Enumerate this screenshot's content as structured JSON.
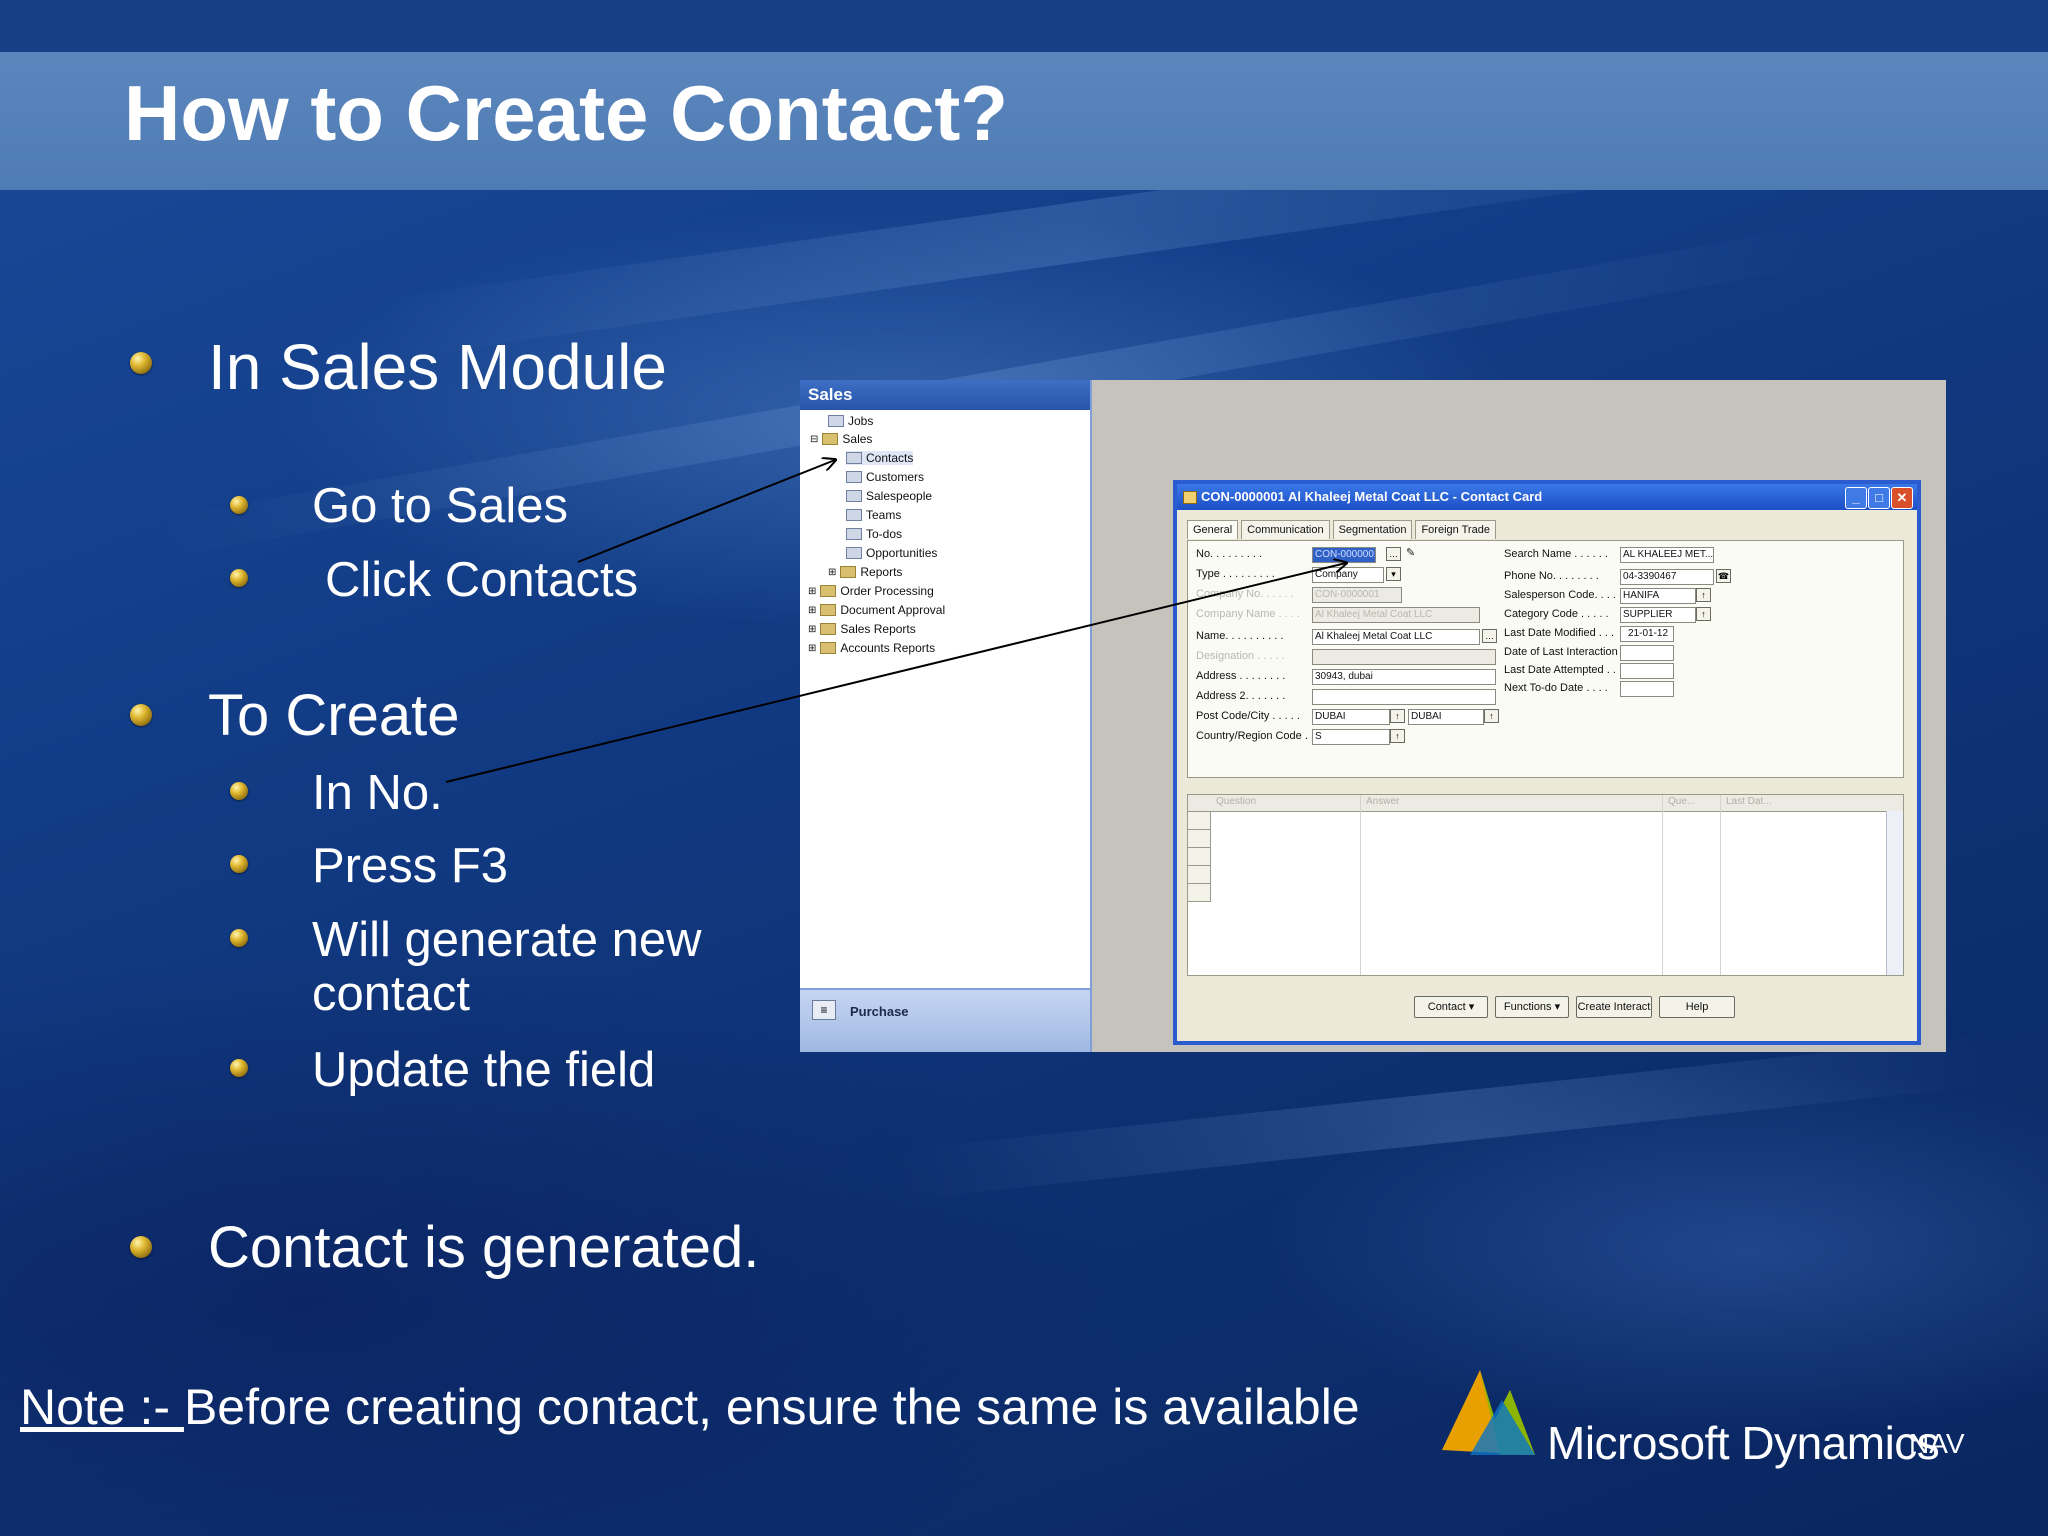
{
  "slide": {
    "title": "How to Create Contact?",
    "bullets": {
      "b1": "In Sales Module",
      "b1_1": "Go to Sales",
      "b1_2": "Click Contacts",
      "b2": "To Create",
      "b2_1": "In No.",
      "b2_2": "Press F3",
      "b2_3a": "Will generate new",
      "b2_3b": "contact",
      "b2_4": "Update the field",
      "b3": "Contact is generated."
    },
    "note": {
      "prefix": "Note :- ",
      "text": "Before creating contact, ensure the same is available"
    },
    "logo": {
      "brand": "Microsoft Dynamics",
      "suffix": "NAV"
    }
  },
  "nav_pane": {
    "header": "Sales",
    "tree": {
      "jobs": "Jobs",
      "sales": "Sales",
      "contacts": "Contacts",
      "customers": "Customers",
      "salespeople": "Salespeople",
      "teams": "Teams",
      "todos": "To-dos",
      "opportunities": "Opportunities",
      "reports": "Reports",
      "order_processing": "Order Processing",
      "document_approval": "Document Approval",
      "sales_reports": "Sales Reports",
      "accounts_reports": "Accounts Reports"
    },
    "footer": "Purchase"
  },
  "contact_card": {
    "window_title": "CON-0000001 Al Khaleej Metal Coat LLC - Contact Card",
    "tabs": {
      "general": "General",
      "communication": "Communication",
      "segmentation": "Segmentation",
      "foreign_trade": "Foreign Trade"
    },
    "left_labels": {
      "no": "No. . . . . . . . .",
      "type": "Type . . . . . . . . .",
      "company_no": "Company No. . . . . .",
      "company_name": "Company Name . . . .",
      "name": "Name. . . . . . . . . .",
      "designation": "Designation . . . . .",
      "address": "Address . . . . . . . .",
      "address2": "Address 2. . . . . . .",
      "post_code": "Post Code/City . . . . .",
      "country": "Country/Region Code . ."
    },
    "left_values": {
      "no": "CON-0000001",
      "type": "Company",
      "company_no": "CON-0000001",
      "company_name": "Al Khaleej Metal Coat LLC",
      "name": "Al Khaleej Metal Coat LLC",
      "designation": "",
      "address": "30943, dubai",
      "address2": "",
      "post_code": "DUBAI",
      "city": "DUBAI",
      "country": "S"
    },
    "right_labels": {
      "search_name": "Search Name . . . . . .",
      "phone": "Phone No. . . . . . . .",
      "salesperson": "Salesperson Code. . . .",
      "category": "Category Code . . . . .",
      "last_modified": "Last Date Modified . . .",
      "last_interaction": "Date of Last Interaction .",
      "last_attempted": "Last Date Attempted . .",
      "next_todo": "Next To-do Date . . . ."
    },
    "right_values": {
      "search_name": "AL KHALEEJ MET...",
      "phone": "04-3390467",
      "salesperson": "HANIFA",
      "category": "SUPPLIER",
      "last_modified": "21-01-12",
      "last_interaction": "",
      "last_attempted": "",
      "next_todo": ""
    },
    "grid_headers": {
      "question": "Question",
      "answer": "Answer",
      "questions": "Que...",
      "last_date": "Last Dat..."
    },
    "buttons": {
      "contact": "Contact",
      "functions": "Functions",
      "create_interact": "Create Interact",
      "help": "Help"
    }
  },
  "colors": {
    "title_band": "#5b86bd",
    "background": "#123c86",
    "bullet": "#e0b830",
    "window_border": "#2a5cd0"
  }
}
